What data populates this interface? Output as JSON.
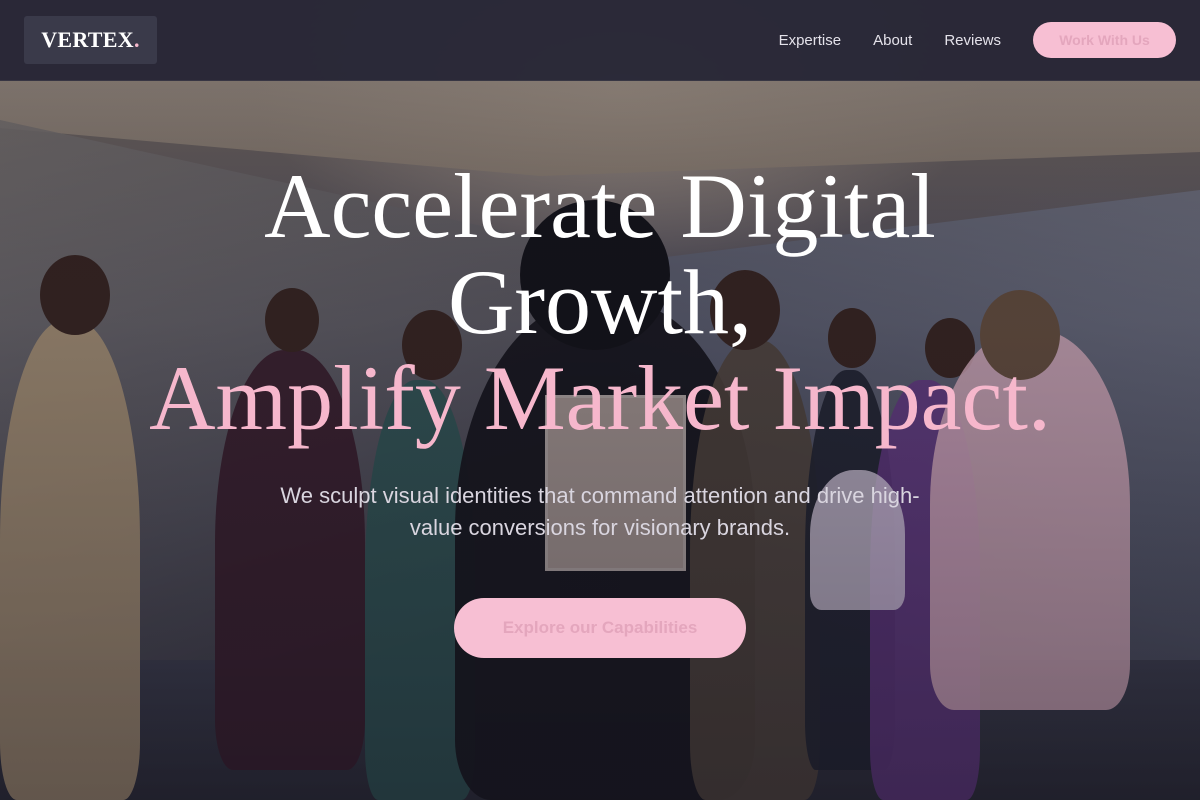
{
  "header": {
    "logo_text": "VERTEX",
    "logo_dot": ".",
    "nav": [
      {
        "label": "Expertise"
      },
      {
        "label": "About"
      },
      {
        "label": "Reviews"
      }
    ],
    "cta_label": "Work With Us"
  },
  "hero": {
    "headline_line1": "Accelerate Digital",
    "headline_line2": "Growth,",
    "headline_accent": "Amplify Market Impact.",
    "subtitle": "We sculpt visual identities that command attention and drive high-value conversions for visionary brands.",
    "cta_label": "Explore our Capabilities"
  },
  "colors": {
    "header_bg": "#28263a",
    "accent_pink": "#f7bfd3",
    "headline_white": "#ffffff",
    "text_muted": "#d9d5df"
  }
}
